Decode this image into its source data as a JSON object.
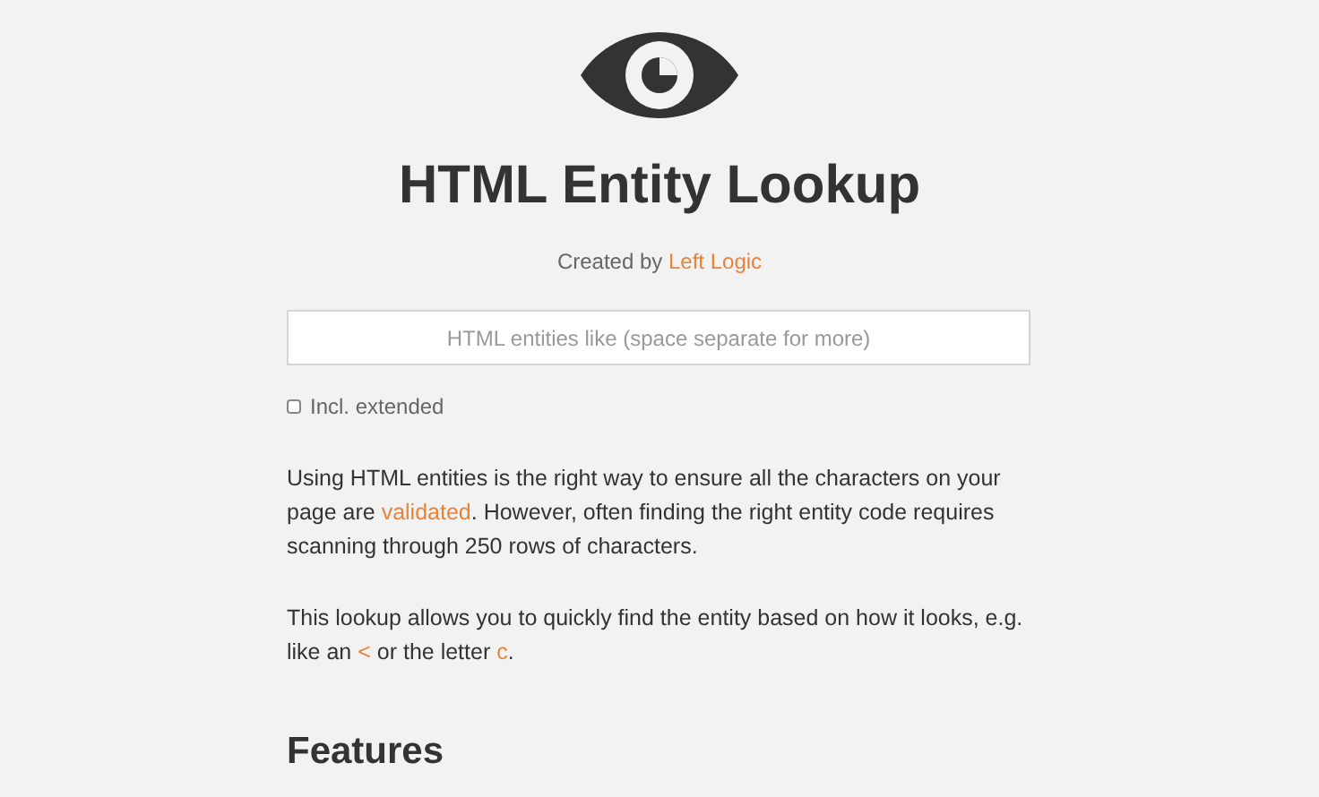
{
  "title": "HTML Entity Lookup",
  "credit": [
    {
      "kind": "text",
      "text": "Created by "
    },
    {
      "kind": "link",
      "text": "Left Logic"
    }
  ],
  "search": {
    "placeholder": "HTML entities like (space separate for more)"
  },
  "extended": {
    "label": "Incl. extended",
    "checked": false
  },
  "paragraphs": [
    [
      {
        "kind": "text",
        "text": "Using HTML entities is the right way to ensure all the characters on your page are "
      },
      {
        "kind": "link",
        "text": "validated"
      },
      {
        "kind": "text",
        "text": ". However, often finding the right entity code requires scanning through 250 rows of characters."
      }
    ],
    [
      {
        "kind": "text",
        "text": "This lookup allows you to quickly find the entity based on how it looks, e.g. like an "
      },
      {
        "kind": "link",
        "text": "<"
      },
      {
        "kind": "text",
        "text": " or the letter "
      },
      {
        "kind": "link",
        "text": "c"
      },
      {
        "kind": "text",
        "text": "."
      }
    ]
  ],
  "section_heading": "Features"
}
